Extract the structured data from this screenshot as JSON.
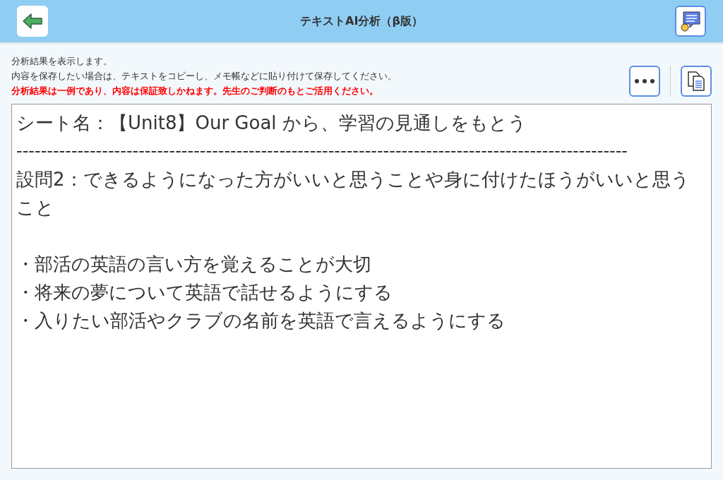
{
  "header": {
    "title": "テキストAI分析（β版）"
  },
  "notice": {
    "lines": [
      {
        "text": "分析結果を表示します。",
        "kind": "normal"
      },
      {
        "text": "内容を保存したい場合は、テキストをコピーし、メモ帳などに貼り付けて保存してください。",
        "kind": "normal"
      },
      {
        "text": "分析結果は一例であり、内容は保証致しかねます。先生のご判断のもとご活用ください。",
        "kind": "warning"
      }
    ]
  },
  "result": {
    "sheet_title": "シート名：【Unit8】Our Goal から、学習の見通しをもとう",
    "divider": "----------------------------------------------------------------------------------------------------",
    "question": "設問2：できるようになった方がいいと思うことや身に付けたほうがいいと思うこと",
    "bullets": [
      "・部活の英語の言い方を覚えることが大切",
      "・将来の夢について英語で話せるようにする",
      "・入りたい部活やクラブの名前を英語で言えるようにする"
    ]
  }
}
